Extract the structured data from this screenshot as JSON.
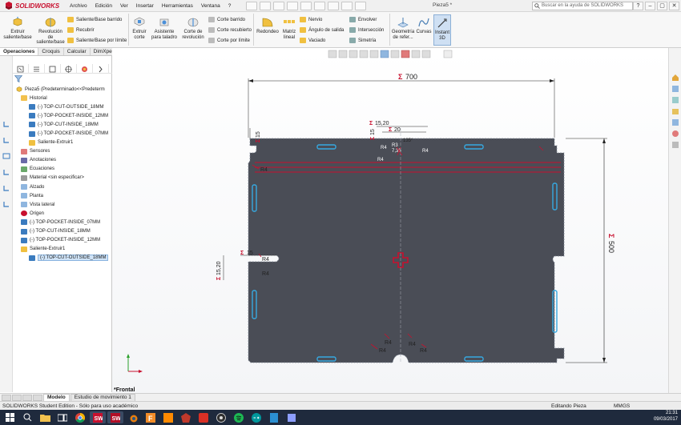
{
  "app": {
    "logo": "SOLIDWORKS",
    "menu": [
      "Archivo",
      "Edición",
      "Ver",
      "Insertar",
      "Herramientas",
      "Ventana",
      "?"
    ],
    "doc_title": "Pieza5 *",
    "search_placeholder": "Buscar en la ayuda de SOLIDWORKS",
    "window_controls": [
      "?",
      "–",
      "▢",
      "✕"
    ]
  },
  "ribbon": {
    "extruir_saliente": "Extruir saliente/base",
    "revolucion_saliente": "Revolución de saliente/base",
    "saliente_barrido": "Saliente/Base barrido",
    "recubrir": "Recubrir",
    "saliente_limite": "Saliente/Base por límite",
    "extruir_corte": "Extruir corte",
    "asistente_taladro": "Asistente para taladro",
    "corte_revolucion": "Corte de revolución",
    "corte_barrido": "Corte barrido",
    "corte_recubierto": "Corte recubierto",
    "corte_limite": "Corte por límite",
    "redondeo": "Redondeo",
    "matriz_lineal": "Matriz lineal",
    "nervio": "Nervio",
    "angulo_salida": "Ángulo de salida",
    "vaciado": "Vaciado",
    "envolver": "Envolver",
    "interseccion": "Intersección",
    "simetria": "Simetría",
    "geometria_referencia": "Geometría de refer...",
    "curvas": "Curvas",
    "instant3d": "Instant 3D"
  },
  "tabs": [
    "Operaciones",
    "Croquis",
    "Calcular",
    "DimXpert"
  ],
  "tree": {
    "root": "Pieza5  (Predeterminado<<Predeterm",
    "items": [
      {
        "label": "Historial",
        "level": 1,
        "icon": "folder-icon"
      },
      {
        "label": "(-) TOP-CUT-OUTSIDE_18MM",
        "level": 2,
        "icon": "sketch-icon"
      },
      {
        "label": "(-) TOP-POCKET-INSIDE_12MM",
        "level": 2,
        "icon": "sketch-icon"
      },
      {
        "label": "(-) TOP-CUT-INSIDE_18MM",
        "level": 2,
        "icon": "sketch-icon"
      },
      {
        "label": "(-) TOP-POCKET-INSIDE_07MM",
        "level": 2,
        "icon": "sketch-icon"
      },
      {
        "label": "Saliente-Extruir1",
        "level": 2,
        "icon": "extrude-icon"
      },
      {
        "label": "Sensores",
        "level": 1,
        "icon": "sensor-icon"
      },
      {
        "label": "Anotaciones",
        "level": 1,
        "icon": "annotation-icon"
      },
      {
        "label": "Ecuaciones",
        "level": 1,
        "icon": "equation-icon"
      },
      {
        "label": "Material <sin especificar>",
        "level": 1,
        "icon": "material-icon"
      },
      {
        "label": "Alzado",
        "level": 1,
        "icon": "plane-icon"
      },
      {
        "label": "Planta",
        "level": 1,
        "icon": "plane-icon"
      },
      {
        "label": "Vista lateral",
        "level": 1,
        "icon": "plane-icon"
      },
      {
        "label": "Origen",
        "level": 1,
        "icon": "origin-icon"
      },
      {
        "label": "(-) TOP-POCKET-INSIDE_07MM",
        "level": 1,
        "icon": "sketch-icon"
      },
      {
        "label": "(-) TOP-CUT-INSIDE_18MM",
        "level": 1,
        "icon": "sketch-icon"
      },
      {
        "label": "(-) TOP-POCKET-INSIDE_12MM",
        "level": 1,
        "icon": "sketch-icon"
      },
      {
        "label": "Saliente-Extruir1",
        "level": 1,
        "icon": "extrude-icon"
      },
      {
        "label": "(-) TOP-CUT-OUTSIDE_18MM",
        "level": 2,
        "icon": "sketch-icon",
        "selected": true
      }
    ]
  },
  "dimensions": {
    "width": "700",
    "height": "500",
    "d15_20_top": "15,20",
    "d20_top": "20",
    "d15_top": "15",
    "d15_left_top": "15",
    "d15_20_left": "15,20",
    "d15_left": "15",
    "r4": "R4",
    "r3": "R3",
    "angle135": "135°",
    "d7_35": "7,35"
  },
  "view_label": "*Frontal",
  "model_tabs": [
    "Modelo",
    "Estudio de movimiento 1"
  ],
  "status": {
    "edition": "SOLIDWORKS Student Edition - Sólo para uso académico",
    "editing": "Editando Pieza",
    "units": "MMGS"
  },
  "taskbar": {
    "time": "21:31",
    "date": "09/03/2017",
    "apps": [
      "windows-start",
      "search",
      "file-explorer",
      "task-view",
      "chrome",
      "solidworks",
      "solidworks-2",
      "blender",
      "fusion",
      "illustrator",
      "sketchup",
      "acrobat",
      "obs",
      "spotify",
      "arduino",
      "notes",
      "teams"
    ]
  },
  "colors": {
    "part_fill": "#4a4d56",
    "dimension_red": "#c8102e",
    "slot_blue": "#36a9e1",
    "selection_blue": "#3c8fe0"
  }
}
